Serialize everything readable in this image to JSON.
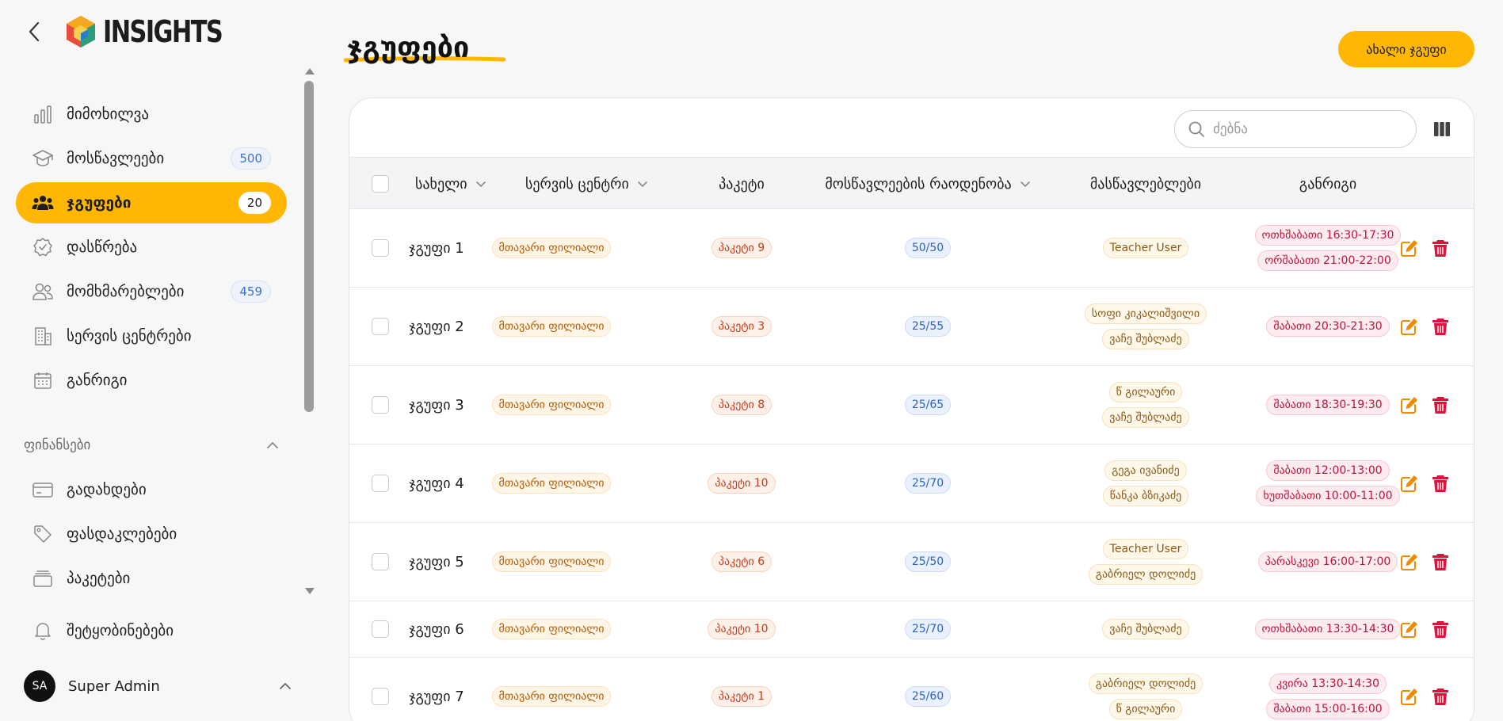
{
  "brand": {
    "name": "INSIGHTS"
  },
  "nav": [
    {
      "label": "მიმოხილვა",
      "icon": "bar-chart-icon",
      "badge": ""
    },
    {
      "label": "მოსწავლეები",
      "icon": "graduation-cap-icon",
      "badge": "500"
    },
    {
      "label": "ჯგუფები",
      "icon": "group-icon",
      "badge": "20",
      "active": true
    },
    {
      "label": "დასწრება",
      "icon": "badge-check-icon",
      "badge": ""
    },
    {
      "label": "მომხმარებლები",
      "icon": "users-icon",
      "badge": "459"
    },
    {
      "label": "სერვის ცენტრები",
      "icon": "building-icon",
      "badge": ""
    },
    {
      "label": "განრიგი",
      "icon": "calendar-icon",
      "badge": ""
    }
  ],
  "finance": {
    "label": "ფინანსები",
    "items": [
      {
        "label": "გადახდები",
        "icon": "credit-card-icon"
      },
      {
        "label": "ფასდაკლებები",
        "icon": "tag-icon"
      },
      {
        "label": "პაკეტები",
        "icon": "layers-icon"
      }
    ]
  },
  "notifications": {
    "label": "შეტყობინებები"
  },
  "user": {
    "initials": "SA",
    "name": "Super Admin"
  },
  "page": {
    "title": "ჯგუფები",
    "new_button": "ახალი ჯგუფი"
  },
  "search": {
    "placeholder": "ძებნა"
  },
  "colors": {
    "accent": "#ffb703",
    "danger": "#e0113a",
    "edit": "#f08a00"
  },
  "table": {
    "columns": [
      "სახელი",
      "სერვის ცენტრი",
      "პაკეტი",
      "მოსწავლეების რაოდენობა",
      "მასწავლებლები",
      "განრიგი"
    ],
    "rows": [
      {
        "name": "ჯგუფი 1",
        "center": "მთავარი ფილიალი",
        "package": "პაკეტი 9",
        "count": "50/50",
        "teachers": [
          "Teacher User"
        ],
        "schedule": [
          "ოთხშაბათი 16:30-17:30",
          "ორშაბათი 21:00-22:00"
        ]
      },
      {
        "name": "ჯგუფი 2",
        "center": "მთავარი ფილიალი",
        "package": "პაკეტი 3",
        "count": "25/55",
        "teachers": [
          "სოფი კიკალიშვილი",
          "ვაჩე შუბლაძე"
        ],
        "schedule": [
          "შაბათი 20:30-21:30"
        ]
      },
      {
        "name": "ჯგუფი 3",
        "center": "მთავარი ფილიალი",
        "package": "პაკეტი 8",
        "count": "25/65",
        "teachers": [
          "წ გილაური",
          "ვაჩე შუბლაძე"
        ],
        "schedule": [
          "შაბათი 18:30-19:30"
        ]
      },
      {
        "name": "ჯგუფი 4",
        "center": "მთავარი ფილიალი",
        "package": "პაკეტი 10",
        "count": "25/70",
        "teachers": [
          "გეგა ივანიძე",
          "წანკა ბზიკაძე"
        ],
        "schedule": [
          "შაბათი 12:00-13:00",
          "ხუთშაბათი 10:00-11:00"
        ]
      },
      {
        "name": "ჯგუფი 5",
        "center": "მთავარი ფილიალი",
        "package": "პაკეტი 6",
        "count": "25/50",
        "teachers": [
          "Teacher User",
          "გაბრიელ დოლიძე"
        ],
        "schedule": [
          "პარასკევი 16:00-17:00"
        ]
      },
      {
        "name": "ჯგუფი 6",
        "center": "მთავარი ფილიალი",
        "package": "პაკეტი 10",
        "count": "25/70",
        "teachers": [
          "ვაჩე შუბლაძე"
        ],
        "schedule": [
          "ოთხშაბათი 13:30-14:30"
        ]
      },
      {
        "name": "ჯგუფი 7",
        "center": "მთავარი ფილიალი",
        "package": "პაკეტი 1",
        "count": "25/60",
        "teachers": [
          "გაბრიელ დოლიძე",
          "წ გილაური"
        ],
        "schedule": [
          "კვირა 13:30-14:30",
          "შაბათი 15:00-16:00"
        ]
      }
    ]
  }
}
